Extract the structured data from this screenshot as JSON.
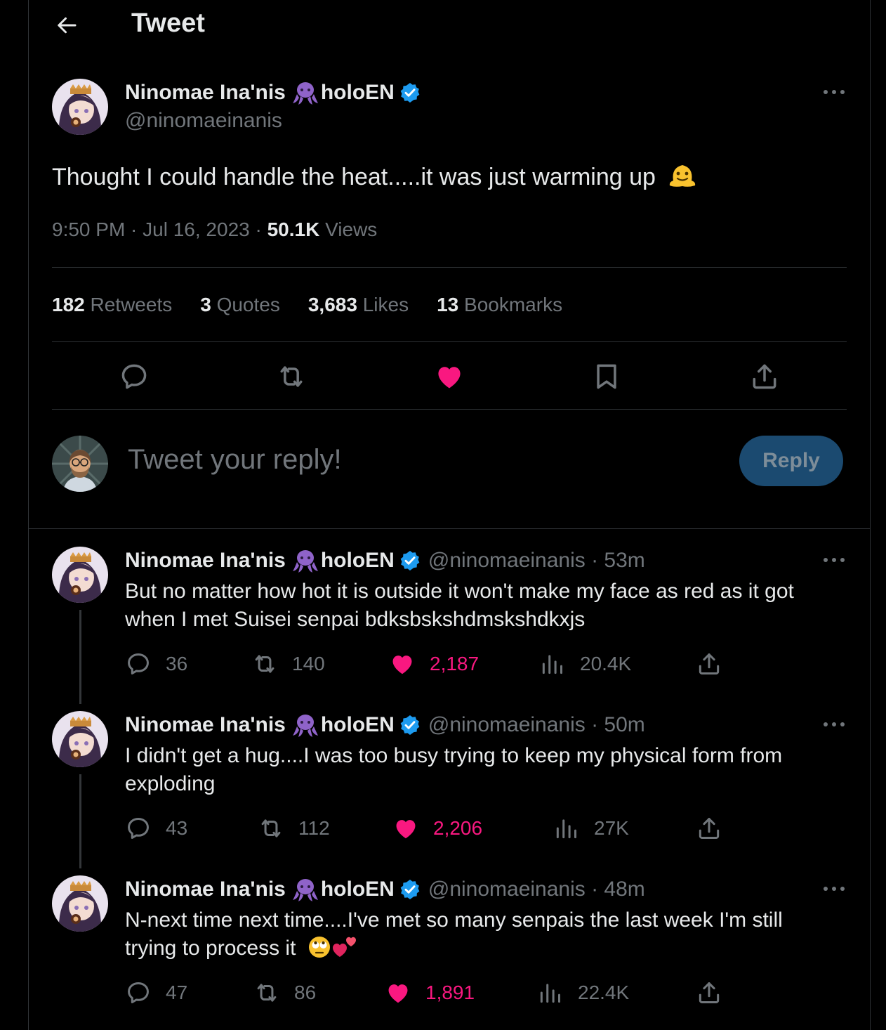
{
  "header": {
    "title": "Tweet"
  },
  "colors": {
    "accent": "#1d9bf0",
    "like": "#f91880",
    "verified": "#1d9bf0",
    "reply_button_bg": "#1b4a70"
  },
  "tweet": {
    "author_name": "Ninomae Ina'nis",
    "author_suffix": "holoEN",
    "author_handle": "@ninomaeinanis",
    "text": "Thought I could handle the heat.....it was just warming up",
    "emoji": "melting-face",
    "time": "9:50 PM · Jul 16, 2023 ·",
    "views_count": "50.1K",
    "views_label": "Views",
    "stats": {
      "retweets_count": "182",
      "retweets_label": "Retweets",
      "quotes_count": "3",
      "quotes_label": "Quotes",
      "likes_count": "3,683",
      "likes_label": "Likes",
      "bookmarks_count": "13",
      "bookmarks_label": "Bookmarks"
    },
    "liked": true
  },
  "composer": {
    "placeholder": "Tweet your reply!",
    "reply_label": "Reply"
  },
  "replies": [
    {
      "name": "Ninomae Ina'nis",
      "suffix": "holoEN",
      "meta": "@ninomaeinanis · 53m",
      "text": "But no matter how hot it is outside it won't make my face as red as it got when I met Suisei senpai bdksbskshdmskshdkxjs",
      "replies": "36",
      "retweets": "140",
      "likes": "2,187",
      "views": "20.4K"
    },
    {
      "name": "Ninomae Ina'nis",
      "suffix": "holoEN",
      "meta": "@ninomaeinanis · 50m",
      "text": "I didn't get a hug....I was too busy trying to keep my physical form from exploding",
      "replies": "43",
      "retweets": "112",
      "likes": "2,206",
      "views": "27K"
    },
    {
      "name": "Ninomae Ina'nis",
      "suffix": "holoEN",
      "meta": "@ninomaeinanis · 48m",
      "text": "N-next time next time....I've met so many senpais the last week I'm still trying to process it",
      "emojis": [
        "face-with-rolling-eyes",
        "two-hearts"
      ],
      "replies": "47",
      "retweets": "86",
      "likes": "1,891",
      "views": "22.4K"
    }
  ]
}
